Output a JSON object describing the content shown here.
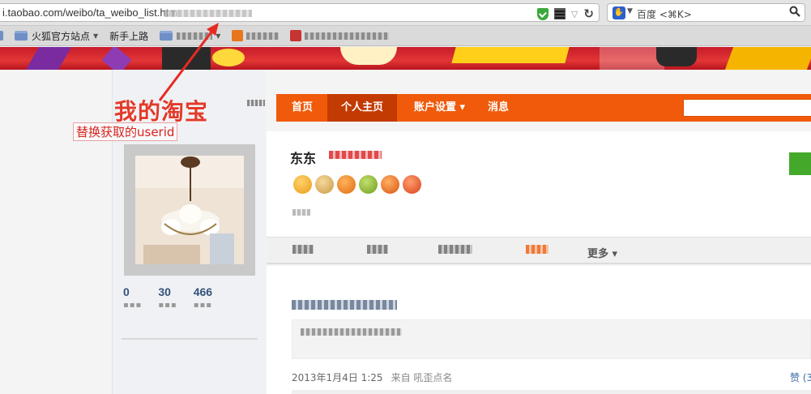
{
  "browser": {
    "url": "i.taobao.com/weibo/ta_weibo_list.htm",
    "search_placeholder": "百度 <⌘K>",
    "search_engine_icon": "baidu-paw-icon",
    "bookmarks": [
      {
        "label": "火狐官方站点",
        "icon": "folder-icon",
        "dropdown": true
      },
      {
        "label": "新手上路",
        "icon": "page-icon",
        "dropdown": false
      }
    ]
  },
  "nav": {
    "items": [
      {
        "label": "首页",
        "active": false
      },
      {
        "label": "个人主页",
        "active": true
      },
      {
        "label": "账户设置 ▾",
        "active": false
      },
      {
        "label": "消息",
        "active": false
      }
    ]
  },
  "profile": {
    "name": "东东"
  },
  "stats": [
    {
      "value": "0"
    },
    {
      "value": "30"
    },
    {
      "value": "466"
    }
  ],
  "tabs": {
    "more_label": "更多 ▾"
  },
  "feed": {
    "timestamp": "2013年1月4日 1:25",
    "source": "来自 吼歪点名",
    "action": "赞 (3"
  },
  "annotation": {
    "title": "我的淘宝",
    "hint": "替换获取的userid"
  },
  "colors": {
    "nav_orange": "#f05a0a",
    "nav_active": "#c33a02",
    "annotation_red": "#e23a2a",
    "follow_green": "#44a82a",
    "banner_red": "#d9202f"
  }
}
